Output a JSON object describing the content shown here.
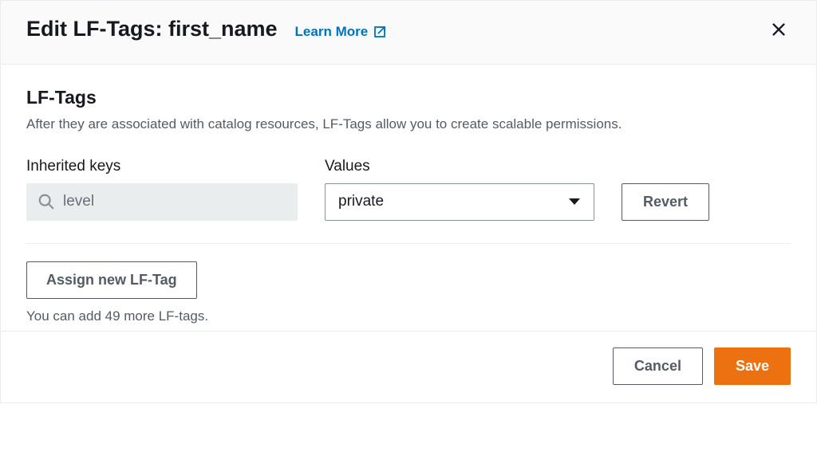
{
  "header": {
    "title": "Edit LF-Tags: first_name",
    "learn_more": "Learn More"
  },
  "body": {
    "section_title": "LF-Tags",
    "section_desc": "After they are associated with catalog resources, LF-Tags allow you to create scalable permissions.",
    "inherited_keys_label": "Inherited keys",
    "values_label": "Values",
    "key_value": "level",
    "selected_value": "private",
    "revert_label": "Revert",
    "assign_label": "Assign new LF-Tag",
    "hint": "You can add 49 more LF-tags."
  },
  "footer": {
    "cancel": "Cancel",
    "save": "Save"
  },
  "colors": {
    "accent_link": "#0073bb",
    "primary_button": "#ec7211"
  }
}
